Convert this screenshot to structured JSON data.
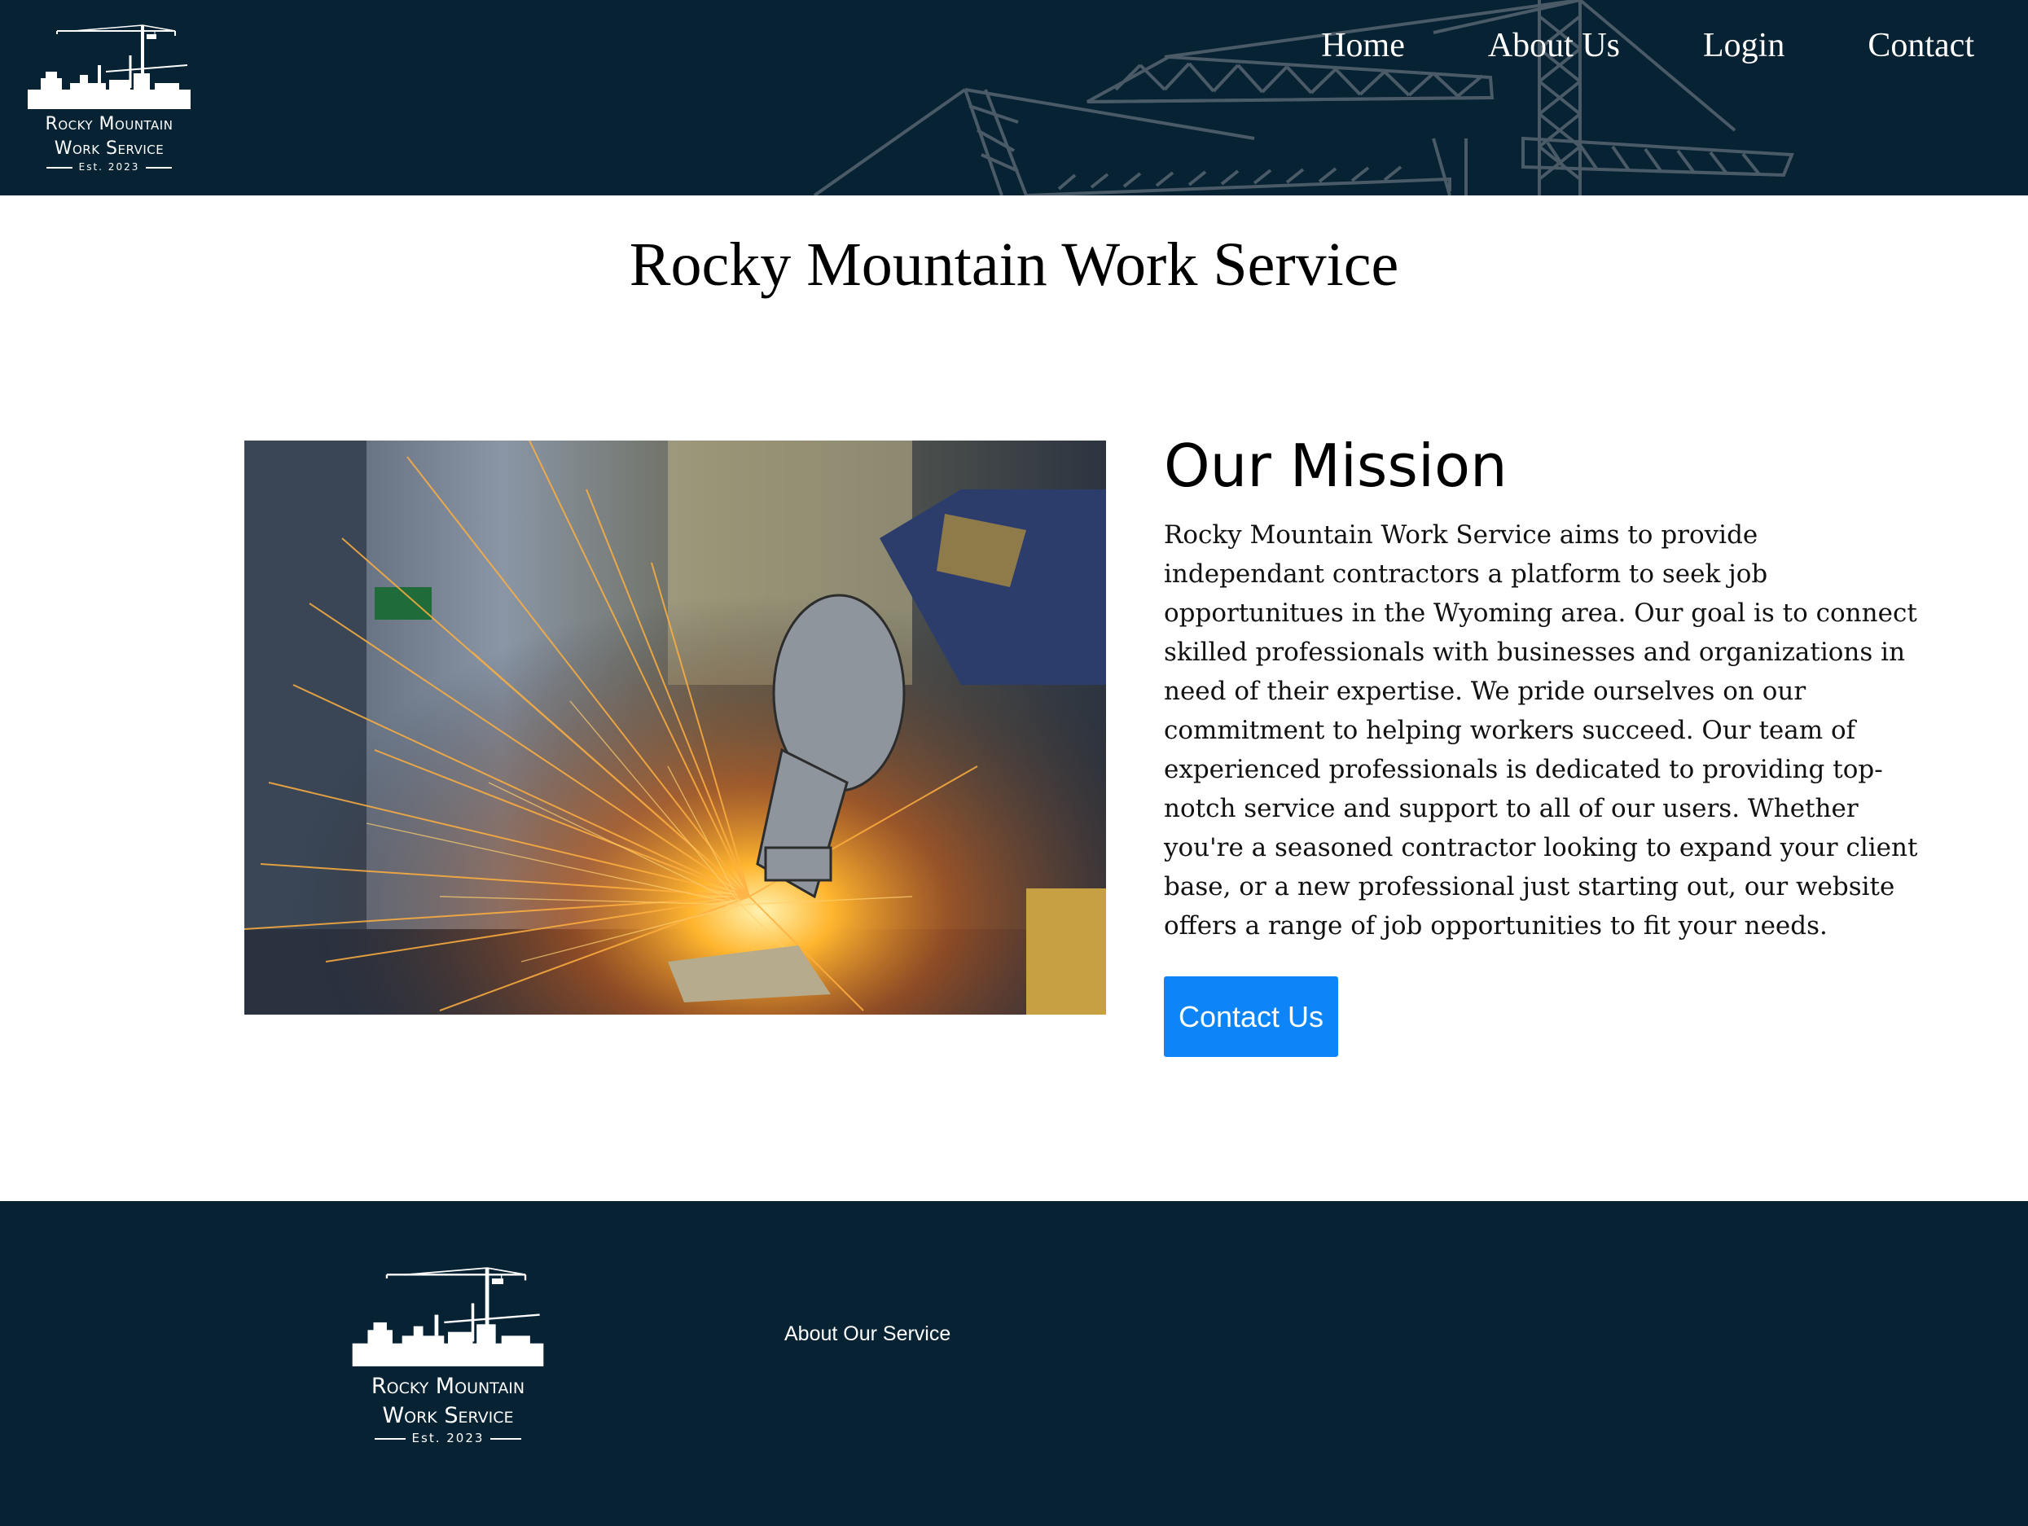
{
  "brand": {
    "line1": "Rocky Mountain",
    "line2": "Work Service",
    "est": "Est. 2023"
  },
  "nav": {
    "items": [
      {
        "label": "Home"
      },
      {
        "label": "About Us"
      },
      {
        "label": "Login"
      },
      {
        "label": "Contact"
      }
    ]
  },
  "page": {
    "title": "Rocky Mountain Work Service"
  },
  "mission": {
    "heading": "Our Mission",
    "body": "Rocky Mountain Work Service aims to provide independant contractors a platform to seek job opportunitues in the Wyoming area. Our goal is to connect skilled professionals with businesses and organizations in need of their expertise. We pride ourselves on our commitment to helping workers succeed. Our team of experienced professionals is dedicated to providing top-notch service and support to all of our users. Whether you're a seasoned contractor looking to expand your client base, or a new professional just starting out, our website offers a range of job opportunities to fit your needs.",
    "button_label": "Contact Us"
  },
  "footer": {
    "link_label": "About Our Service"
  },
  "colors": {
    "header_bg": "#062233",
    "footer_bg": "#062233",
    "button_bg": "#0d85f8",
    "crane_lines": "#4a5a66"
  },
  "icons": {
    "logo": "crane-city-logo-icon",
    "hero": "angle-grinder-sparks-photo"
  }
}
